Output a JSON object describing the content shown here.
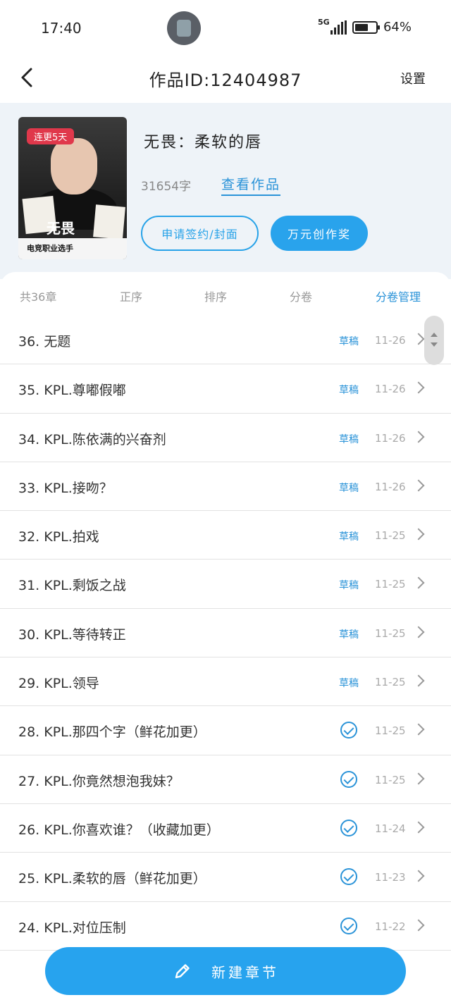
{
  "status": {
    "time": "17:40",
    "network": "5G",
    "battery": "64%",
    "battery_level": 0.64
  },
  "nav": {
    "title": "作品ID:12404987",
    "settings": "设置"
  },
  "work": {
    "cover_badge": "连更5天",
    "cover_text": "无畏",
    "cover_band": "电竞职业选手",
    "title": "无畏：柔软的唇",
    "word_count": "31654字",
    "view_link": "查看作品",
    "sign_button": "申请签约/封面",
    "award_button": "万元创作奖"
  },
  "tabs": {
    "count": "共36章",
    "order": "正序",
    "sort": "排序",
    "volume": "分卷",
    "volume_manage": "分卷管理"
  },
  "chapters": [
    {
      "title": "36. 无题",
      "status": "草稿",
      "date": "11-26",
      "published": false
    },
    {
      "title": "35. KPL.尊嘟假嘟",
      "status": "草稿",
      "date": "11-26",
      "published": false
    },
    {
      "title": "34. KPL.陈依满的兴奋剂",
      "status": "草稿",
      "date": "11-26",
      "published": false
    },
    {
      "title": "33. KPL.接吻？",
      "status": "草稿",
      "date": "11-26",
      "published": false
    },
    {
      "title": "32. KPL.拍戏",
      "status": "草稿",
      "date": "11-25",
      "published": false
    },
    {
      "title": "31. KPL.剩饭之战",
      "status": "草稿",
      "date": "11-25",
      "published": false
    },
    {
      "title": "30. KPL.等待转正",
      "status": "草稿",
      "date": "11-25",
      "published": false
    },
    {
      "title": "29. KPL.领导",
      "status": "草稿",
      "date": "11-25",
      "published": false
    },
    {
      "title": "28. KPL.那四个字（鲜花加更）",
      "status": "",
      "date": "11-25",
      "published": true
    },
    {
      "title": "27. KPL.你竟然想泡我妹？",
      "status": "",
      "date": "11-25",
      "published": true
    },
    {
      "title": "26. KPL.你喜欢谁？（收藏加更）",
      "status": "",
      "date": "11-24",
      "published": true
    },
    {
      "title": "25. KPL.柔软的唇（鲜花加更）",
      "status": "",
      "date": "11-23",
      "published": true
    },
    {
      "title": "24. KPL.对位压制",
      "status": "",
      "date": "11-22",
      "published": true
    }
  ],
  "fab": {
    "label": "新建章节"
  },
  "colors": {
    "accent": "#27a3ee",
    "link": "#2a93d8",
    "card_bg": "#eef3f8"
  }
}
